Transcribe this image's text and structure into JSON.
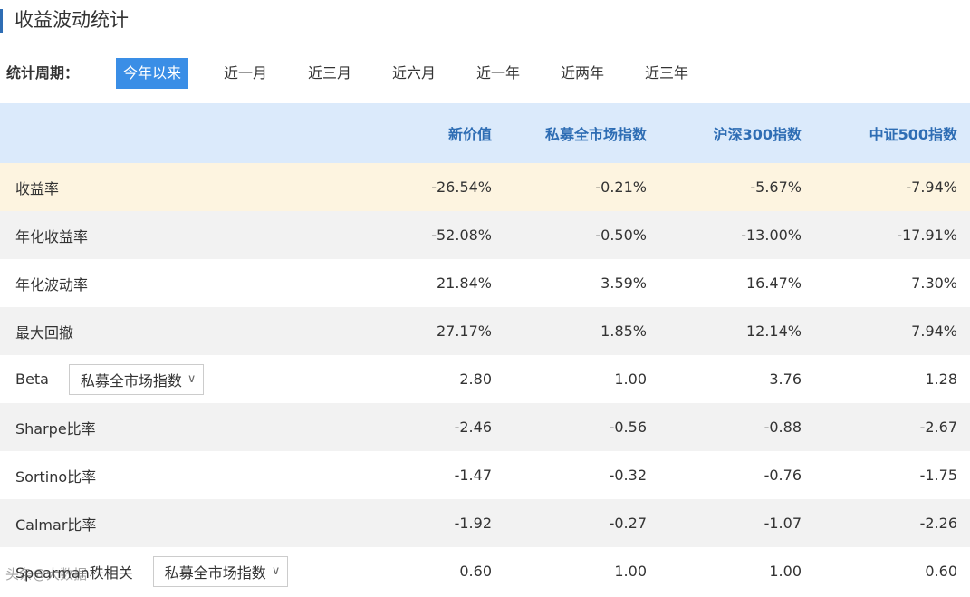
{
  "title": "收益波动统计",
  "period": {
    "label": "统计周期：",
    "options": [
      "今年以来",
      "近一月",
      "近三月",
      "近六月",
      "近一年",
      "近两年",
      "近三年"
    ],
    "active": "今年以来"
  },
  "table": {
    "headers": [
      "",
      "新价值",
      "私募全市场指数",
      "沪深300指数",
      "中证500指数"
    ],
    "rows": [
      {
        "label": "收益率",
        "values": [
          "-26.54%",
          "-0.21%",
          "-5.67%",
          "-7.94%"
        ]
      },
      {
        "label": "年化收益率",
        "values": [
          "-52.08%",
          "-0.50%",
          "-13.00%",
          "-17.91%"
        ]
      },
      {
        "label": "年化波动率",
        "values": [
          "21.84%",
          "3.59%",
          "16.47%",
          "7.30%"
        ]
      },
      {
        "label": "最大回撤",
        "values": [
          "27.17%",
          "1.85%",
          "12.14%",
          "7.94%"
        ]
      },
      {
        "label": "Beta",
        "select": "私募全市场指数",
        "values": [
          "2.80",
          "1.00",
          "3.76",
          "1.28"
        ]
      },
      {
        "label": "Sharpe比率",
        "values": [
          "-2.46",
          "-0.56",
          "-0.88",
          "-2.67"
        ]
      },
      {
        "label": "Sortino比率",
        "values": [
          "-1.47",
          "-0.32",
          "-0.76",
          "-1.75"
        ]
      },
      {
        "label": "Calmar比率",
        "values": [
          "-1.92",
          "-0.27",
          "-1.07",
          "-2.26"
        ]
      },
      {
        "label": "Spearman秩相关",
        "select": "私募全市场指数",
        "values": [
          "0.60",
          "1.00",
          "1.00",
          "0.60"
        ]
      }
    ]
  },
  "watermark": "头条@大数据"
}
